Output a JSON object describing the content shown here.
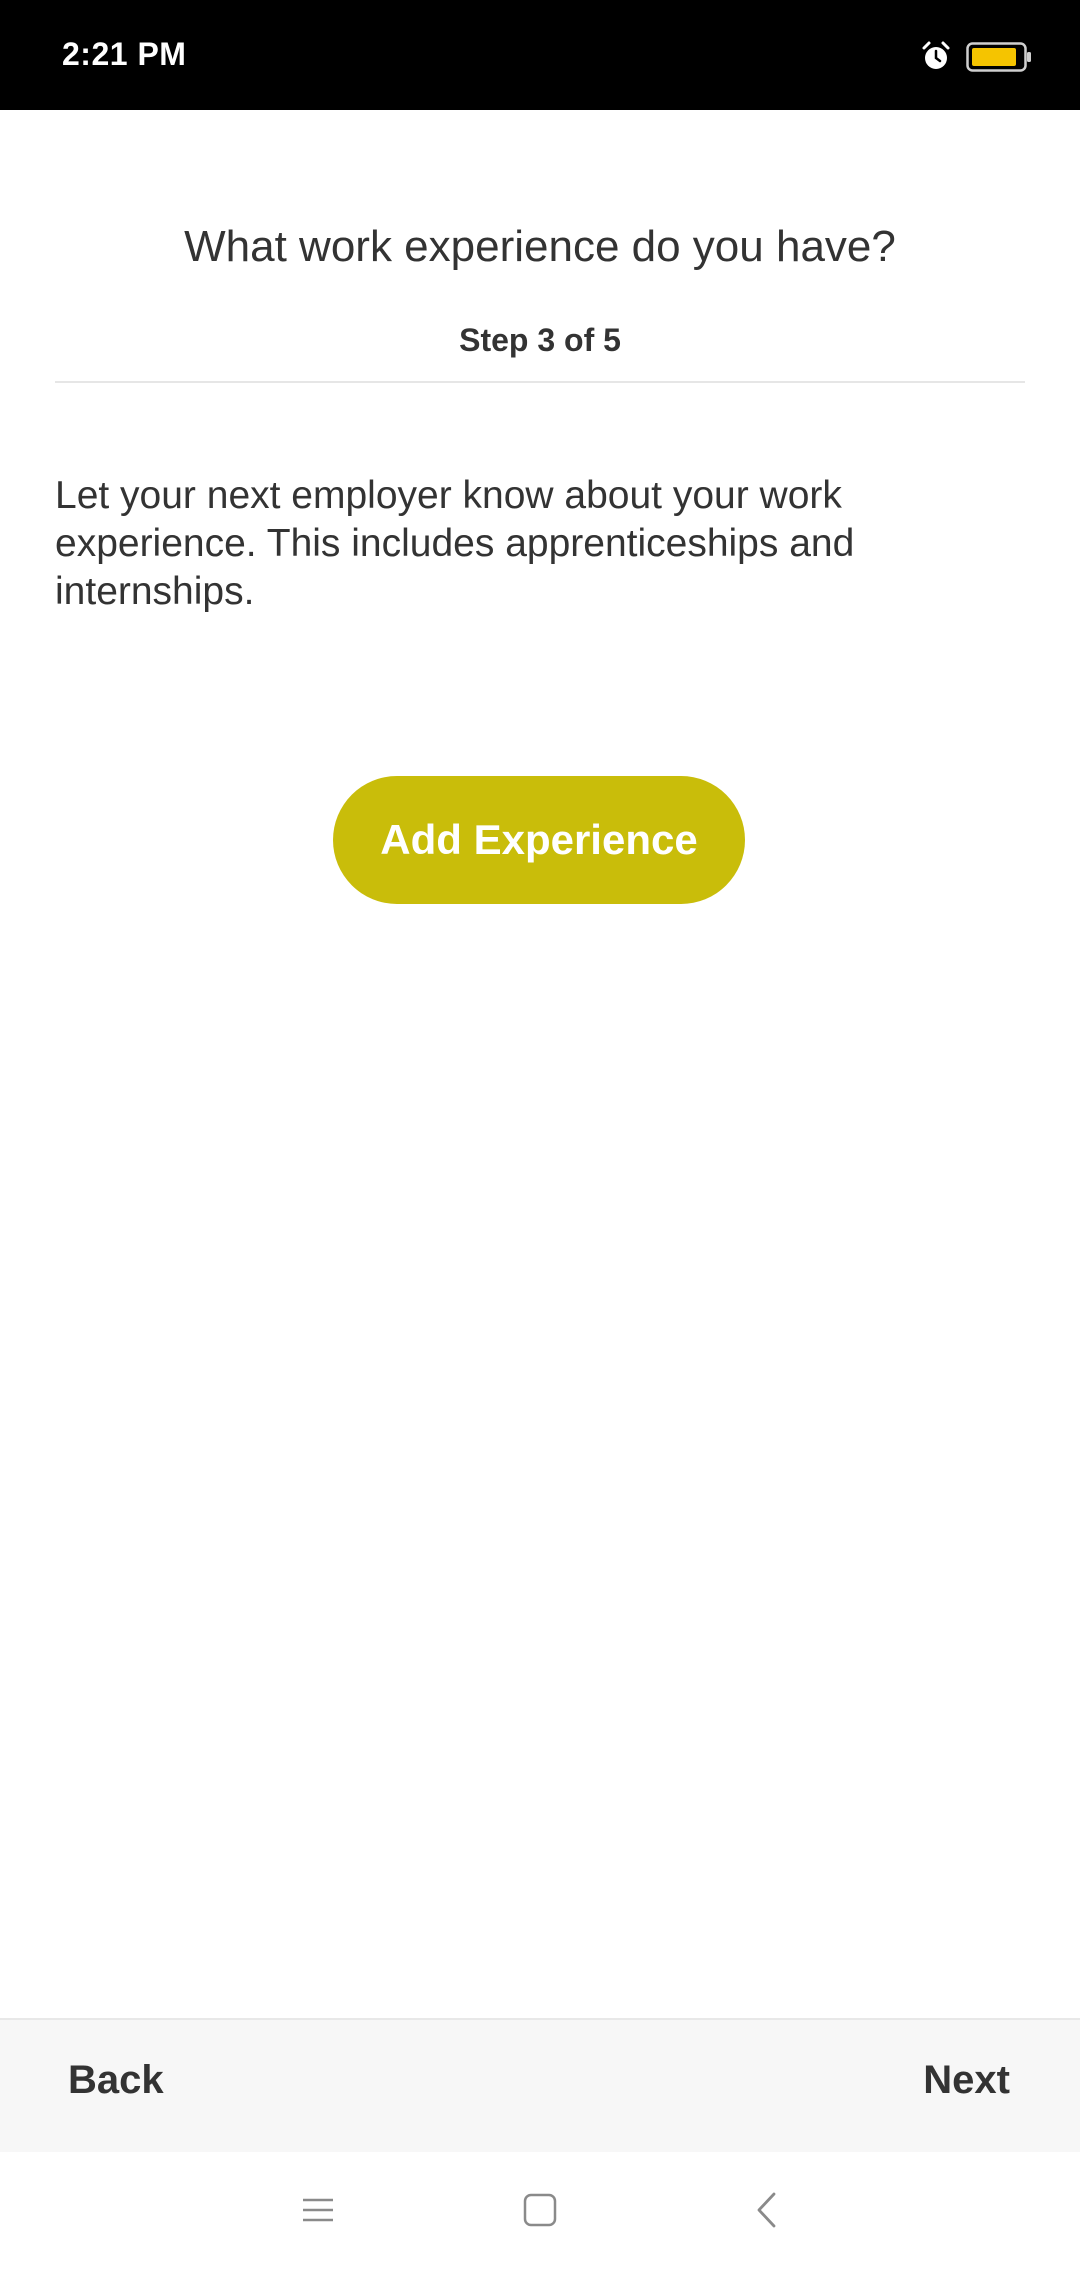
{
  "status_bar": {
    "time": "2:21 PM",
    "icons": [
      "alarm-icon",
      "battery-icon"
    ],
    "battery_color": "#f5c400"
  },
  "header": {
    "title": "What work experience do you have?",
    "step": "Step 3 of 5"
  },
  "main": {
    "description": "Let your next employer know about your work experience. This includes apprenticeships and internships.",
    "add_button_label": "Add Experience",
    "accent_color": "#c9bd0a"
  },
  "footer": {
    "back_label": "Back",
    "next_label": "Next"
  },
  "system_nav": {
    "icons": [
      "menu-icon",
      "home-icon",
      "back-arrow-icon"
    ]
  }
}
